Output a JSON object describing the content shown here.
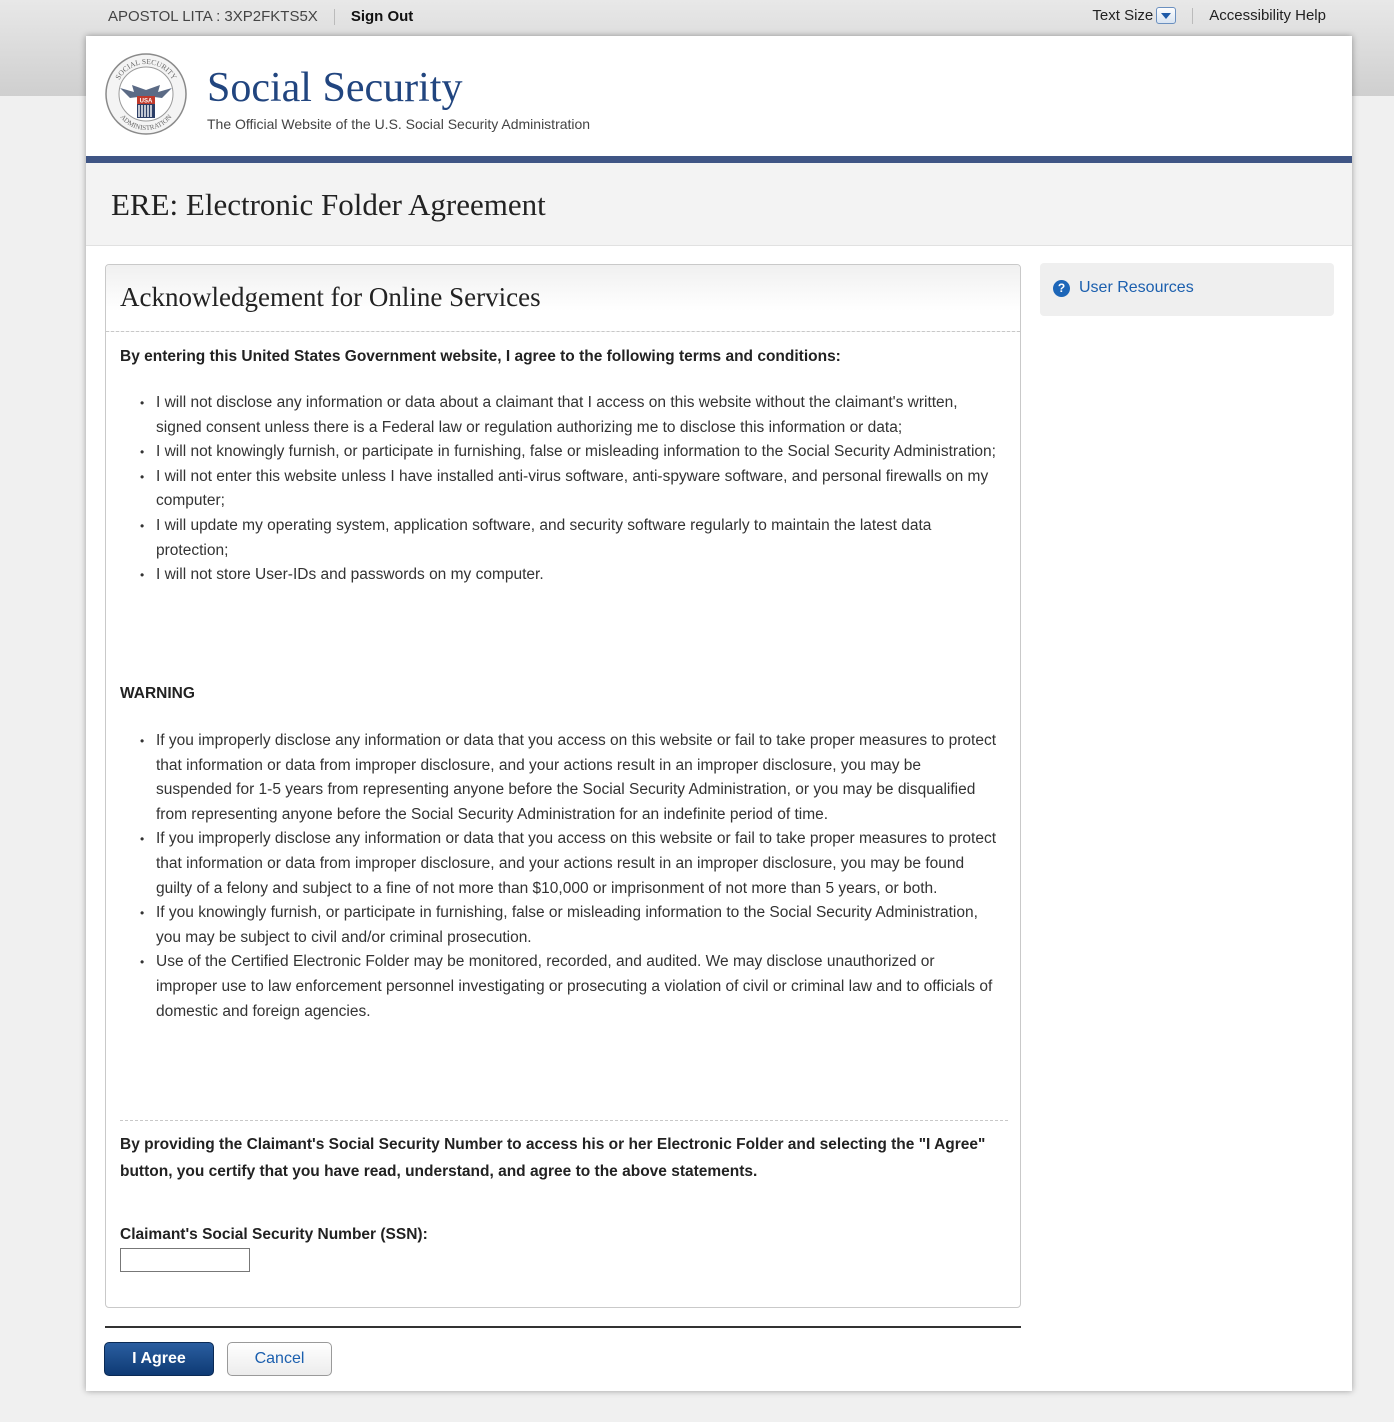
{
  "util": {
    "user": "APOSTOL LITA : 3XP2FKTS5X",
    "sign_out": "Sign Out",
    "text_size": "Text Size",
    "accessibility_help": "Accessibility Help"
  },
  "header": {
    "brand_title": "Social Security",
    "brand_subtitle": "The Official Website of the U.S. Social Security Administration",
    "seal_text": "SOCIAL SECURITY ADMINISTRATION USA"
  },
  "page": {
    "title": "ERE: Electronic Folder Agreement"
  },
  "panel": {
    "title": "Acknowledgement for Online Services",
    "terms_intro": "By entering this United States Government website, I agree to the following terms and conditions:",
    "terms": [
      "I will not disclose any information or data about a claimant that I access on this website without the claimant's written, signed consent unless there is a Federal law or regulation authorizing me to disclose this information or data;",
      "I will not knowingly furnish, or participate in furnishing, false or misleading information to the Social Security Administration;",
      "I will not enter this website unless I have installed anti-virus software, anti-spyware software, and personal firewalls on my computer;",
      "I will update my operating system, application software, and security software regularly to maintain the latest data protection;",
      "I will not store User-IDs and passwords on my computer."
    ],
    "warning_title": "WARNING",
    "warnings": [
      "If you improperly disclose any information or data that you access on this website or fail to take proper measures to protect that information or data from improper disclosure, and your actions result in an improper disclosure, you may be suspended for 1-5 years from representing anyone before the Social Security Administration, or you may be disqualified from representing anyone before the Social Security Administration for an indefinite period of time.",
      "If you improperly disclose any information or data that you access on this website or fail to take proper measures to protect that information or data from improper disclosure, and your actions result in an improper disclosure, you may be found guilty of a felony and subject to a fine of not more than $10,000 or imprisonment of not more than 5 years, or both.",
      "If you knowingly furnish, or participate in furnishing, false or misleading information to the Social Security Administration, you may be subject to civil and/or criminal prosecution.",
      "Use of the Certified Electronic Folder may be monitored, recorded, and audited. We may disclose unauthorized or improper use to law enforcement personnel investigating or prosecuting a violation of civil or criminal law and to officials of domestic and foreign agencies."
    ],
    "certify": "By providing the Claimant's Social Security Number to access his or her Electronic Folder and selecting the \"I Agree\" button, you certify that you have read, understand, and agree to the above statements.",
    "ssn_label": "Claimant's Social Security Number (SSN):",
    "ssn_value": ""
  },
  "sidebar": {
    "resources_label": "User Resources"
  },
  "actions": {
    "agree": "I Agree",
    "cancel": "Cancel"
  },
  "colors": {
    "brand_blue": "#21457f",
    "header_rule": "#3f5585",
    "link_blue": "#1b5fae",
    "primary_button": "#0e3a74"
  }
}
